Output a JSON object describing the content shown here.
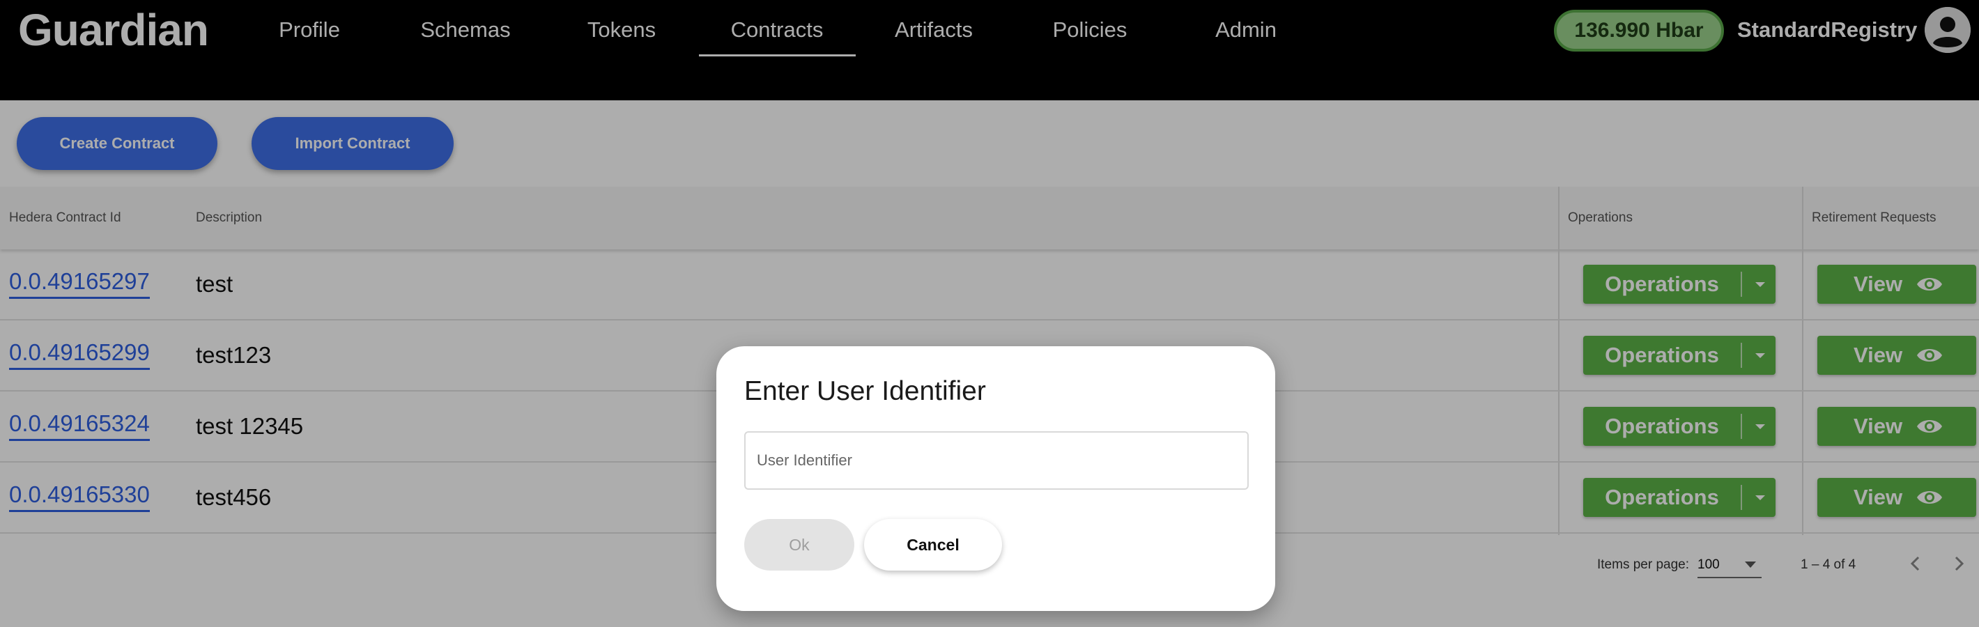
{
  "header": {
    "logo": "Guardian",
    "nav": [
      {
        "label": "Profile"
      },
      {
        "label": "Schemas"
      },
      {
        "label": "Tokens"
      },
      {
        "label": "Contracts"
      },
      {
        "label": "Artifacts"
      },
      {
        "label": "Policies"
      },
      {
        "label": "Admin"
      }
    ],
    "active_nav": "Contracts",
    "balance": "136.990 Hbar",
    "username": "StandardRegistry",
    "avatar_icon": "account-circle-icon"
  },
  "toolbar": {
    "create_label": "Create Contract",
    "import_label": "Import Contract"
  },
  "table": {
    "headers": {
      "id": "Hedera Contract Id",
      "description": "Description",
      "operations": "Operations",
      "retirement": "Retirement Requests"
    },
    "rows": [
      {
        "id": "0.0.49165297",
        "description": "test",
        "operations_label": "Operations",
        "view_label": "View"
      },
      {
        "id": "0.0.49165299",
        "description": "test123",
        "operations_label": "Operations",
        "view_label": "View"
      },
      {
        "id": "0.0.49165324",
        "description": "test 12345",
        "operations_label": "Operations",
        "view_label": "View"
      },
      {
        "id": "0.0.49165330",
        "description": "test456",
        "operations_label": "Operations",
        "view_label": "View"
      }
    ]
  },
  "paginator": {
    "items_per_page_label": "Items per page:",
    "items_per_page": "100",
    "range": "1 – 4 of 4"
  },
  "dialog": {
    "title": "Enter User Identifier",
    "input_placeholder": "User Identifier",
    "input_value": "",
    "ok_label": "Ok",
    "cancel_label": "Cancel"
  },
  "colors": {
    "header_bg": "#000000",
    "primary_blue": "#3f6fe8",
    "link_blue": "#2f5fe0",
    "action_green": "#5cb347",
    "balance_bg": "#9bd28c"
  }
}
